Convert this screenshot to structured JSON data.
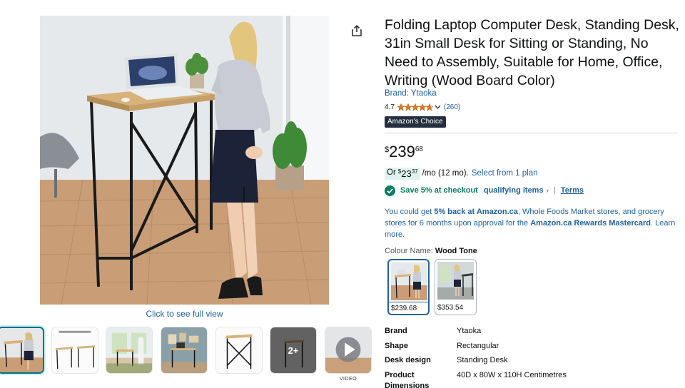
{
  "product": {
    "title": "Folding Laptop Computer Desk, Standing Desk, 31in Small Desk for Sitting or Standing, No Need to Assembly, Suitable for Home, Office, Writing (Wood Board Color)",
    "brand_link": "Brand: Ytaoka",
    "rating": "4.7",
    "stars_value": 4.7,
    "review_count": "(260)",
    "badge": "Amazon's Choice"
  },
  "gallery": {
    "see_full_view": "Click to see full view",
    "more_count": "2+",
    "video_label": "VIDEO"
  },
  "price": {
    "symbol": "$",
    "whole": "239",
    "fraction": "68"
  },
  "monthly": {
    "prefix": "Or",
    "symbol": "$",
    "whole": "23",
    "fraction": "37",
    "term": "/mo (12 mo).",
    "plan_link": "Select from 1 plan"
  },
  "coupon": {
    "save_text": "Save 5% at checkout",
    "qualifying": "qualifying items",
    "separator": "|",
    "terms": "Terms"
  },
  "promo": {
    "p1": "You could get ",
    "p2": "5% back at Amazon.ca",
    "p3": ", Whole Foods Market stores, and grocery stores for 6 months upon approval for the ",
    "p4": "Amazon.ca Rewards Mastercard",
    "p5": ". Learn more."
  },
  "colour": {
    "label": "Colour Name: ",
    "selected": "Wood Tone",
    "options": [
      {
        "price": "$239.68"
      },
      {
        "price": "$353.54"
      }
    ]
  },
  "specs": [
    {
      "key": "Brand",
      "value": "Ytaoka"
    },
    {
      "key": "Shape",
      "value": "Rectangular"
    },
    {
      "key": "Desk design",
      "value": "Standing Desk"
    },
    {
      "key": "Product Dimensions",
      "value": "40D x 80W x 110H Centimetres"
    }
  ],
  "colors": {
    "link": "#2162a1",
    "save_green": "#067d62",
    "badge_bg": "#232f3e",
    "star": "#de7921",
    "selected_border": "#007185"
  },
  "icons": [
    "share-icon",
    "star-icon",
    "chevron-down-icon",
    "check-circle-icon",
    "chevron-right-icon",
    "play-icon"
  ]
}
